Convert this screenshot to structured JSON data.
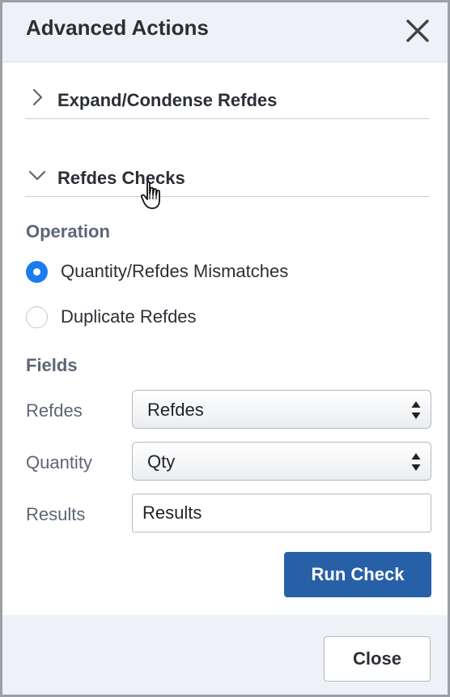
{
  "dialog": {
    "title": "Advanced Actions"
  },
  "sections": [
    {
      "label": "Expand/Condense Refdes",
      "expanded": false
    },
    {
      "label": "Refdes Checks",
      "expanded": true
    }
  ],
  "operation": {
    "label": "Operation",
    "options": [
      {
        "label": "Quantity/Refdes Mismatches",
        "selected": true
      },
      {
        "label": "Duplicate Refdes",
        "selected": false
      }
    ]
  },
  "fields": {
    "label": "Fields",
    "refdes": {
      "label": "Refdes",
      "value": "Refdes"
    },
    "quantity": {
      "label": "Quantity",
      "value": "Qty"
    },
    "results": {
      "label": "Results",
      "value": "Results"
    }
  },
  "buttons": {
    "run_check": "Run Check",
    "close": "Close"
  },
  "colors": {
    "primary": "#2860a8",
    "radio_selected": "#1a7cf2",
    "header_bg": "#eef1f6"
  },
  "icons": {
    "close": "close-icon",
    "collapsed": "chevron-right-icon",
    "expanded": "chevron-down-icon",
    "pointer": "hand-pointer-icon",
    "select": "up-down-arrows-icon"
  }
}
